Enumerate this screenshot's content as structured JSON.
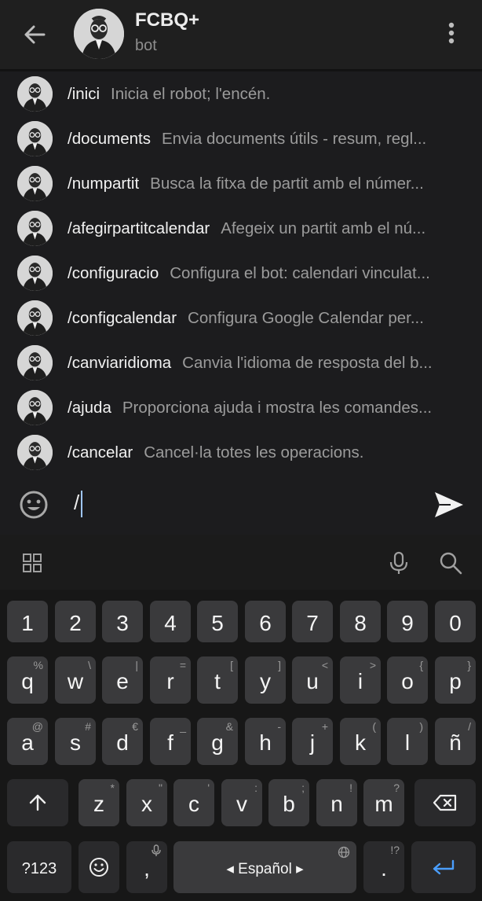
{
  "header": {
    "title": "FCBQ+",
    "subtitle": "bot"
  },
  "commands": [
    {
      "name": "/inici",
      "desc": "Inicia el robot; l'encén."
    },
    {
      "name": "/documents",
      "desc": "Envia documents útils - resum, regl..."
    },
    {
      "name": "/numpartit",
      "desc": "Busca la fitxa de partit amb el númer..."
    },
    {
      "name": "/afegirpartitcalendar",
      "desc": "Afegeix un partit amb el nú..."
    },
    {
      "name": "/configuracio",
      "desc": "Configura el bot: calendari vinculat..."
    },
    {
      "name": "/configcalendar",
      "desc": "Configura Google Calendar per..."
    },
    {
      "name": "/canviaridioma",
      "desc": "Canvia l'idioma de resposta del b..."
    },
    {
      "name": "/ajuda",
      "desc": "Proporciona ajuda i mostra les comandes..."
    },
    {
      "name": "/cancelar",
      "desc": "Cancel·la totes les operacions."
    }
  ],
  "input": {
    "value": "/"
  },
  "keyboard": {
    "numbers": [
      "1",
      "2",
      "3",
      "4",
      "5",
      "6",
      "7",
      "8",
      "9",
      "0"
    ],
    "row1": [
      {
        "k": "q",
        "h": "%"
      },
      {
        "k": "w",
        "h": "\\"
      },
      {
        "k": "e",
        "h": "|"
      },
      {
        "k": "r",
        "h": "="
      },
      {
        "k": "t",
        "h": "["
      },
      {
        "k": "y",
        "h": "]"
      },
      {
        "k": "u",
        "h": "<"
      },
      {
        "k": "i",
        "h": ">"
      },
      {
        "k": "o",
        "h": "{"
      },
      {
        "k": "p",
        "h": "}"
      }
    ],
    "row2": [
      {
        "k": "a",
        "h": "@"
      },
      {
        "k": "s",
        "h": "#"
      },
      {
        "k": "d",
        "h": "€"
      },
      {
        "k": "f",
        "h": "_"
      },
      {
        "k": "g",
        "h": "&"
      },
      {
        "k": "h",
        "h": "-"
      },
      {
        "k": "j",
        "h": "+"
      },
      {
        "k": "k",
        "h": "("
      },
      {
        "k": "l",
        "h": ")"
      },
      {
        "k": "ñ",
        "h": "/"
      }
    ],
    "row3": [
      {
        "k": "z",
        "h": "*"
      },
      {
        "k": "x",
        "h": "\""
      },
      {
        "k": "c",
        "h": "'"
      },
      {
        "k": "v",
        "h": ":"
      },
      {
        "k": "b",
        "h": ";"
      },
      {
        "k": "n",
        "h": "!"
      },
      {
        "k": "m",
        "h": "?"
      }
    ],
    "symbols_label": "?123",
    "comma_label": ",",
    "space_label": "◂ Español ▸",
    "period_label": ".",
    "period_hint": "!?"
  },
  "colors": {
    "accent": "#4a9eff",
    "background": "#1c1c1e",
    "key": "#3a3a3c"
  }
}
